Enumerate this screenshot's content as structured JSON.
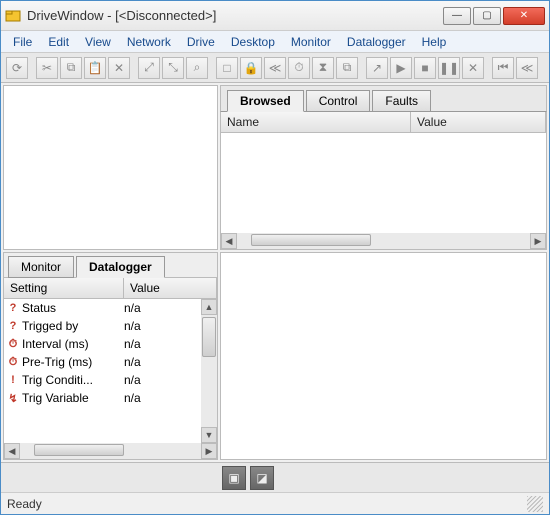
{
  "window": {
    "title": "DriveWindow - [<Disconnected>]"
  },
  "menu": [
    "File",
    "Edit",
    "View",
    "Network",
    "Drive",
    "Desktop",
    "Monitor",
    "Datalogger",
    "Help"
  ],
  "toolbar_groups": [
    [
      "⟳"
    ],
    [
      "✂",
      "⧉",
      "📋",
      "✕"
    ],
    [
      "⤢",
      "⤡",
      "⌕"
    ],
    [
      "□",
      "🔒",
      "≪",
      "⏱",
      "⧗",
      "⧉"
    ],
    [
      "↗",
      "▶",
      "■",
      "❚❚",
      "✕"
    ],
    [
      "⏮",
      "≪"
    ]
  ],
  "right_tabs": {
    "items": [
      "Browsed",
      "Control",
      "Faults"
    ],
    "active": 0
  },
  "right_columns": [
    "Name",
    "Value"
  ],
  "left_tabs": {
    "items": [
      "Monitor",
      "Datalogger"
    ],
    "active": 1
  },
  "left_columns": [
    "Setting",
    "Value"
  ],
  "datalogger_rows": [
    {
      "icon": "?",
      "setting": "Status",
      "value": "n/a"
    },
    {
      "icon": "?",
      "setting": "Trigged by",
      "value": "n/a"
    },
    {
      "icon": "⏱",
      "setting": "Interval (ms)",
      "value": "n/a"
    },
    {
      "icon": "⏱",
      "setting": "Pre-Trig (ms)",
      "value": "n/a"
    },
    {
      "icon": "!",
      "setting": "Trig Conditi...",
      "value": "n/a"
    },
    {
      "icon": "↯",
      "setting": "Trig Variable",
      "value": "n/a"
    }
  ],
  "bottom_buttons": [
    "▣",
    "◪"
  ],
  "status": "Ready"
}
